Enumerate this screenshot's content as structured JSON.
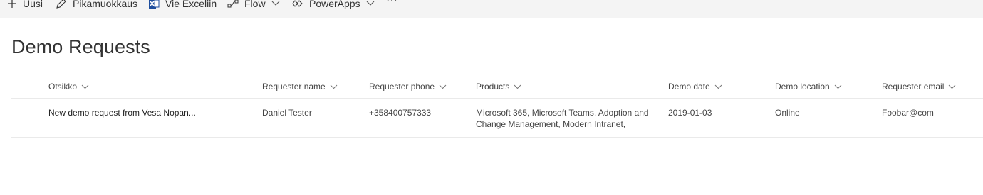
{
  "commandbar": {
    "new_label": "Uusi",
    "quickedit_label": "Pikamuokkaus",
    "export_label": "Vie Exceliin",
    "flow_label": "Flow",
    "powerapps_label": "PowerApps",
    "more_label": "···"
  },
  "list": {
    "title": "Demo Requests",
    "columns": [
      "Otsikko",
      "Requester name",
      "Requester phone",
      "Products",
      "Demo date",
      "Demo location",
      "Requester email"
    ],
    "rows": [
      {
        "title": "New demo request from Vesa Nopan...",
        "requester_name": "Daniel Tester",
        "requester_phone": "+358400757333",
        "products": "Microsoft 365, Microsoft Teams, Adoption and Change Management, Modern Intranet,",
        "demo_date": "2019-01-03",
        "demo_location": "Online",
        "requester_email": "Foobar@com"
      }
    ]
  },
  "icons": {
    "new": "plus-icon",
    "quickedit": "pencil-icon",
    "export": "excel-icon",
    "flow": "flow-icon",
    "powerapps": "powerapps-icon",
    "chevron": "chevron-down-icon"
  },
  "colors": {
    "commandbar_bg": "#f4f4f4",
    "excel_green": "#1f4e9e",
    "text": "#333333",
    "divider": "#eaeaea"
  }
}
